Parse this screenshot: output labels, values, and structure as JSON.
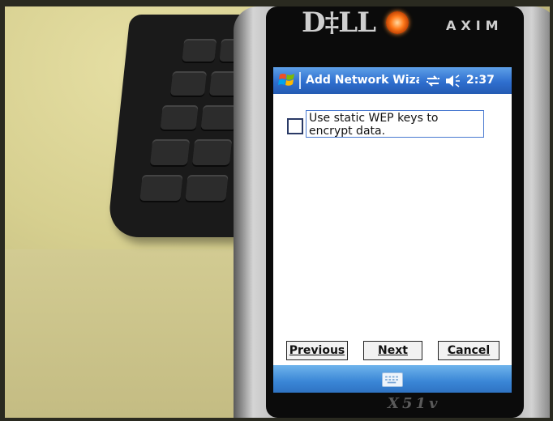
{
  "device": {
    "brand": "D‡LL",
    "model_top": "AXIM",
    "model_bottom": "X51v"
  },
  "titlebar": {
    "title": "Add Network Wizard",
    "time": "2:37",
    "icons": [
      "windows-start-icon",
      "connectivity-icon",
      "volume-icon"
    ]
  },
  "content": {
    "checkbox_label": "Use static WEP keys to encrypt data.",
    "checkbox_checked": false
  },
  "buttons": {
    "previous_label": "Previous",
    "next_label": "Next",
    "cancel_label": "Cancel"
  },
  "bottom_bar": {
    "icons": [
      "keyboard-icon"
    ]
  },
  "colors": {
    "titlebar_blue": "#2f6fcf",
    "bottombar_blue": "#3a86d6"
  }
}
